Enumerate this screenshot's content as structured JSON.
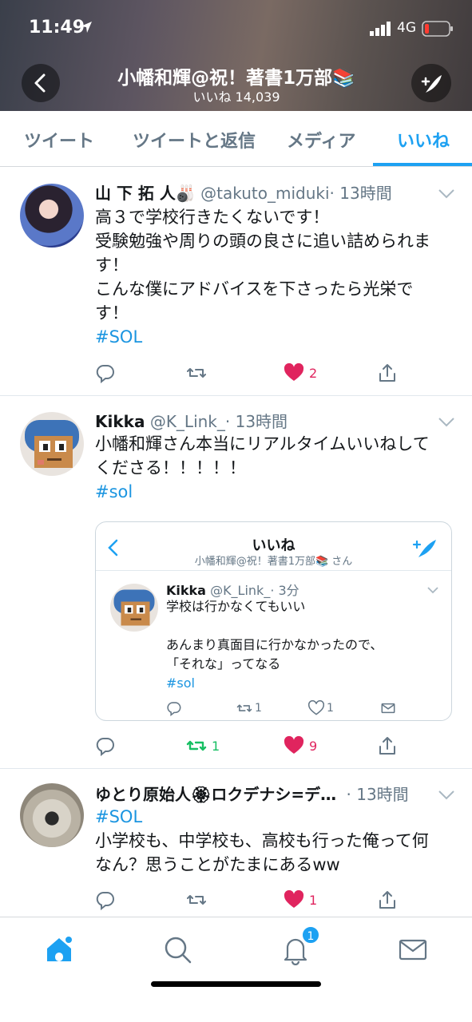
{
  "status_bar": {
    "time": "11:49",
    "network": "4G"
  },
  "header": {
    "title": "小幡和輝@祝！著書1万部📚",
    "subtitle": "いいね 14,039"
  },
  "tabs": [
    {
      "label": "ツイート",
      "active": false
    },
    {
      "label": "ツイートと返信",
      "active": false
    },
    {
      "label": "メディア",
      "active": false
    },
    {
      "label": "いいね",
      "active": true
    }
  ],
  "tweets": [
    {
      "name": "山 下 拓 人🎳",
      "handle": "@takuto_miduki",
      "time": "· 13時間",
      "lines": [
        "高３で学校行きたくないです！",
        "受験勉強や周りの頭の良さに追い詰められま",
        "す！",
        "こんな僕にアドバイスを下さったら光栄で",
        "す！"
      ],
      "hashtag": "#SOL",
      "likes": "2"
    },
    {
      "name": "Kikka",
      "handle": "@K_Link_",
      "time": "· 13時間",
      "lines": [
        "小幡和輝さん本当にリアルタイムいいねして",
        "くださる！！！！！"
      ],
      "hashtag": "#sol",
      "retweets": "1",
      "likes": "9",
      "embed": {
        "title": "いいね",
        "subtitle": "小幡和輝@祝！著書1万部📚 さん",
        "name": "Kikka",
        "handle": "@K_Link_",
        "time": "· 3分",
        "lines": [
          "学校は行かなくてもいい",
          "",
          "あんまり真面目に行かなかったので、",
          "「それな」ってなる"
        ],
        "hashtag": "#sol",
        "retweets": "1",
        "likes": "1"
      }
    },
    {
      "name": "ゆとり原始人🏵ロクデナシ=デ…",
      "time": "· 13時間",
      "hashtag": "#SOL",
      "lines": [
        "小学校も、中学校も、高校も行った俺って何",
        "なん？思うことがたまにあるww"
      ],
      "likes": "1"
    }
  ],
  "bottom_nav": {
    "notification_count": "1"
  },
  "colors": {
    "accent": "#1da1f2",
    "like": "#e0245e",
    "retweet": "#17bf63",
    "muted": "#657786"
  }
}
